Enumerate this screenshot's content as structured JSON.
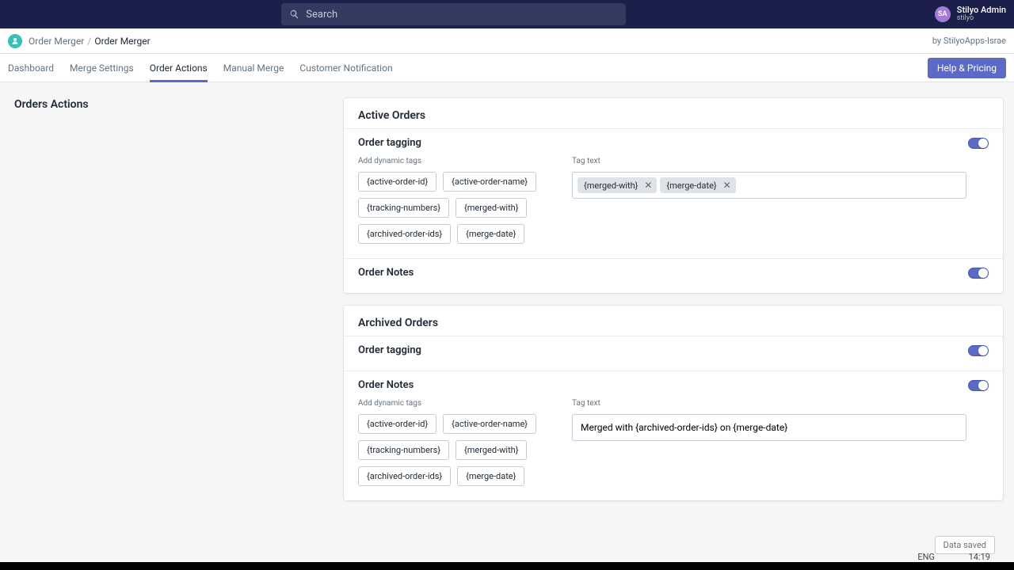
{
  "search": {
    "placeholder": "Search"
  },
  "user": {
    "initials": "SA",
    "name": "Stilyo Admin",
    "sub": "stilyo"
  },
  "breadcrumb": {
    "app": "Order Merger",
    "current": "Order Merger",
    "by": "by StilyoApps-Israe"
  },
  "tabs": {
    "dashboard": "Dashboard",
    "merge_settings": "Merge Settings",
    "order_actions": "Order Actions",
    "manual_merge": "Manual Merge",
    "customer_notification": "Customer Notification"
  },
  "help_button": "Help & Pricing",
  "side_heading": "Orders Actions",
  "labels": {
    "add_dynamic_tags": "Add dynamic tags",
    "tag_text": "Tag text"
  },
  "dynamic_tags": [
    "{active-order-id}",
    "{active-order-name}",
    "{tracking-numbers}",
    "{merged-with}",
    "{archived-order-ids}",
    "{merge-date}"
  ],
  "active": {
    "heading": "Active Orders",
    "tagging": {
      "title": "Order tagging",
      "tokens": [
        "{merged-with}",
        "{merge-date}"
      ]
    },
    "notes": {
      "title": "Order Notes"
    }
  },
  "archived": {
    "heading": "Archived Orders",
    "tagging": {
      "title": "Order tagging"
    },
    "notes": {
      "title": "Order Notes",
      "value": "Merged with {archived-order-ids} on {merge-date}"
    }
  },
  "status": "Data saved",
  "taskbar": {
    "lang": "ENG",
    "time": "14:19"
  }
}
